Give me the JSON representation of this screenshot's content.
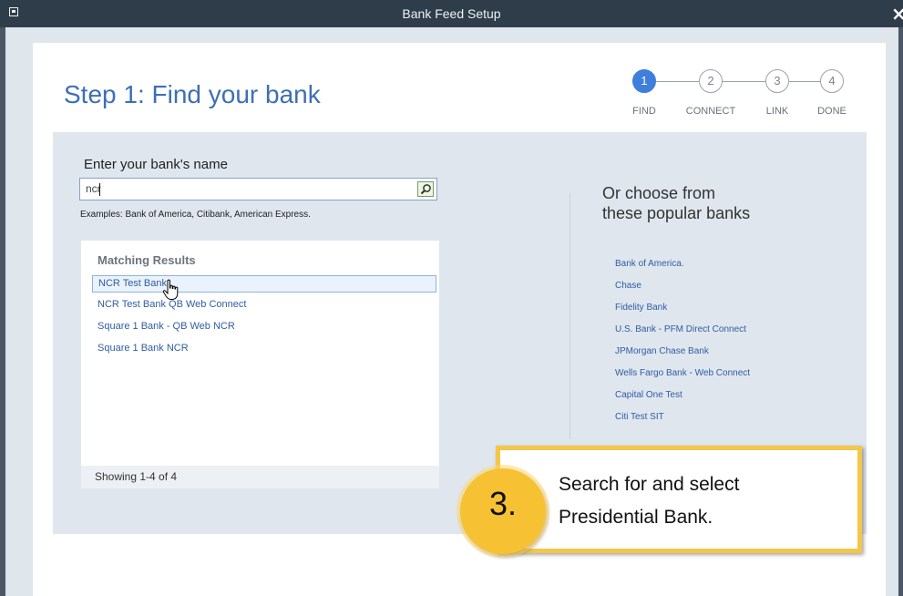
{
  "window": {
    "title": "Bank Feed Setup",
    "close_glyph": "×"
  },
  "page": {
    "step_title": "Step 1: Find your bank"
  },
  "stepper": {
    "steps": [
      {
        "number": "1",
        "label": "FIND",
        "active": true
      },
      {
        "number": "2",
        "label": "CONNECT",
        "active": false
      },
      {
        "number": "3",
        "label": "LINK",
        "active": false
      },
      {
        "number": "4",
        "label": "DONE",
        "active": false
      }
    ]
  },
  "search": {
    "label": "Enter your bank's name",
    "value": "ncr",
    "examples": "Examples: Bank of America, Citibank, American Express."
  },
  "results": {
    "header": "Matching Results",
    "items": [
      "NCR Test Bank",
      "NCR Test Bank QB Web Connect",
      "Square 1 Bank - QB Web NCR",
      "Square 1 Bank NCR"
    ],
    "footer": "Showing 1-4 of 4"
  },
  "popular": {
    "title_line1": "Or choose from",
    "title_line2": "these popular banks",
    "banks": [
      "Bank of America.",
      "Chase",
      "Fidelity Bank",
      "U.S. Bank -  PFM Direct Connect",
      "JPMorgan Chase Bank",
      "Wells Fargo Bank - Web Connect",
      "Capital One Test",
      "Citi Test SIT"
    ]
  },
  "callout": {
    "number": "3.",
    "line1": "Search for and select",
    "line2": "Presidential Bank."
  },
  "colors": {
    "accent": "#3f7fdc",
    "link": "#2f5da3",
    "callout_border": "#f4c64a",
    "badge": "#f6c233"
  },
  "icons": {
    "search": "magnifier-icon",
    "pointer": "hand-pointer-icon"
  }
}
